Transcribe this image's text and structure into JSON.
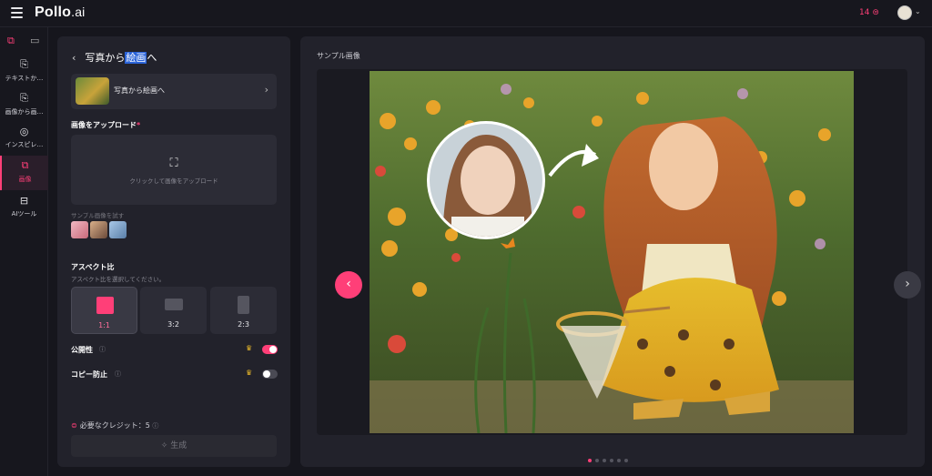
{
  "app": {
    "logo_main": "Pollo",
    "logo_suffix": ".ai",
    "credits_text": "14",
    "accent_color": "#ff3f78"
  },
  "rail": {
    "items": [
      {
        "label": "テキストか…",
        "icon": "text-to-video-icon"
      },
      {
        "label": "画像から画…",
        "icon": "image-to-video-icon"
      },
      {
        "label": "インスピレ…",
        "icon": "compass-icon"
      },
      {
        "label": "画像",
        "icon": "image-icon",
        "active": true
      },
      {
        "label": "AIツール",
        "icon": "toolbox-icon"
      }
    ]
  },
  "panel": {
    "title_prefix": "写真から",
    "title_highlight": "絵画",
    "title_suffix": "へ",
    "template_label": "写真から絵画へ",
    "upload_heading": "画像をアップロード",
    "upload_required_mark": "*",
    "upload_hint": "クリックして画像をアップロード",
    "sample_label": "サンプル画像を試す",
    "aspect_heading": "アスペクト比",
    "aspect_sub": "アスペクト比を選択してください。",
    "ratios": [
      "1:1",
      "3:2",
      "2:3"
    ],
    "selected_ratio": "1:1",
    "public_label": "公開性",
    "public_on": true,
    "copy_protect_label": "コピー防止",
    "copy_protect_on": false,
    "credits_needed": "必要なクレジット：5",
    "generate_label": "生成"
  },
  "preview": {
    "title": "サンプル画像",
    "dots_total": 6,
    "dots_active_index": 0
  }
}
